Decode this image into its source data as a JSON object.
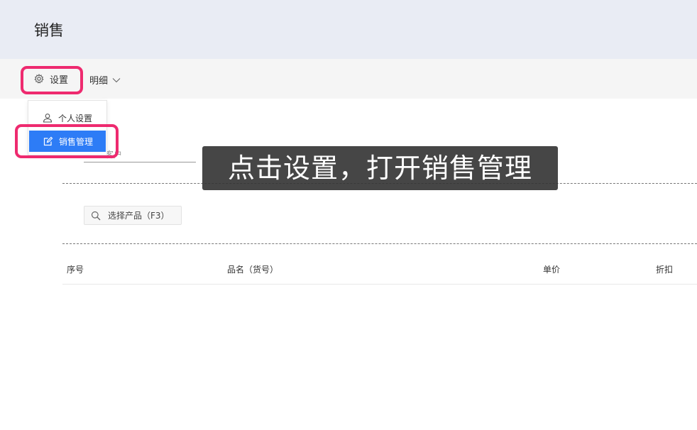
{
  "page": {
    "title": "销售"
  },
  "toolbar": {
    "settings_label": "设置",
    "detail_label": "明细"
  },
  "settings_menu": {
    "items": [
      {
        "label": "个人设置",
        "icon": "user-icon"
      },
      {
        "label": "销售管理",
        "icon": "edit-icon"
      }
    ]
  },
  "form": {
    "customer_label": "客户",
    "product_search_placeholder": "选择产品（F3）"
  },
  "table": {
    "columns": [
      "序号",
      "品名（货号）",
      "单价",
      "折扣"
    ]
  },
  "overlay": {
    "instruction": "点击设置，打开销售管理",
    "highlight_color": "#ee2a6f"
  },
  "colors": {
    "header_bg": "#e9ecf4",
    "toolbar_bg": "#f5f5f5",
    "accent": "#2d7cf6"
  }
}
